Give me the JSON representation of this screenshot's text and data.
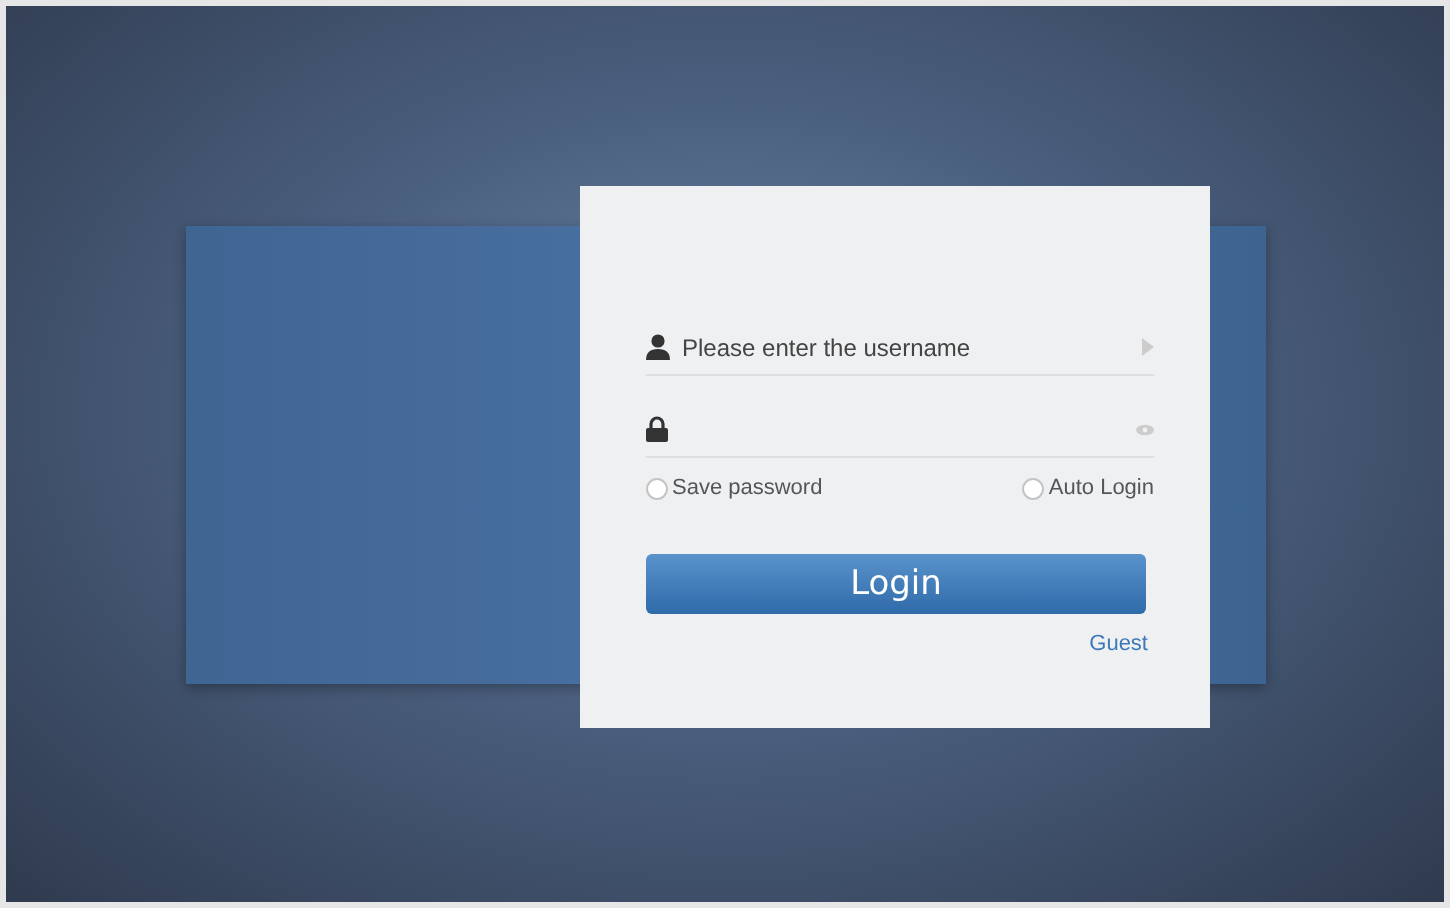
{
  "login_form": {
    "username": {
      "placeholder": "Please enter the username"
    },
    "options": [
      {
        "label": "Save password",
        "checked": false
      },
      {
        "label": "Auto Login",
        "checked": false
      }
    ],
    "login_button": "Login",
    "guest_link": "Guest"
  }
}
